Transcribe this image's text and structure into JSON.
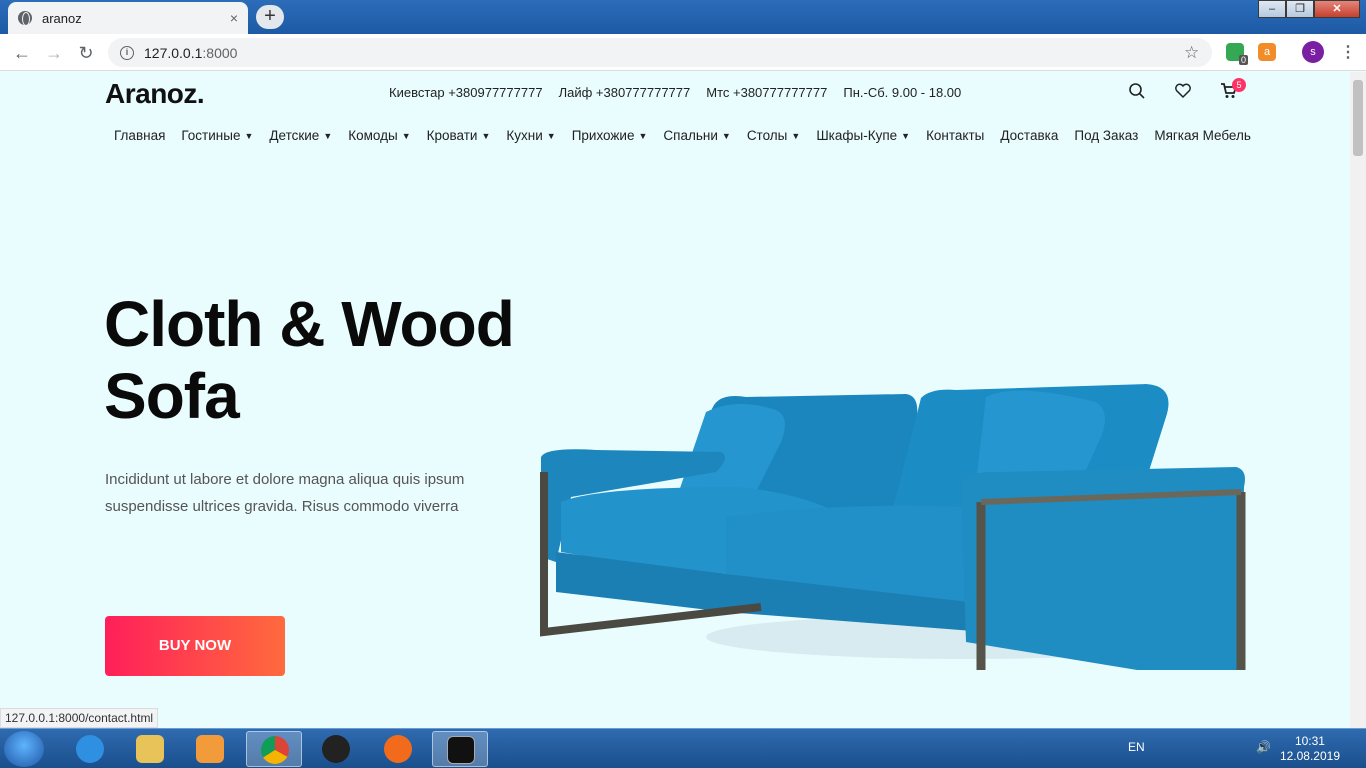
{
  "browser": {
    "tab_title": "aranoz",
    "tab_close": "×",
    "new_tab": "+",
    "url_host": "127.0.0.1",
    "url_port": ":8000",
    "extension_badge": "0",
    "profile_initial": "s",
    "status_url": "127.0.0.1:8000/contact.html"
  },
  "site": {
    "logo": "Aranoz.",
    "contacts": [
      "Киевстар +380977777777",
      "Лайф +380777777777",
      "Мтс +380777777777",
      "Пн.-Сб. 9.00 - 18.00"
    ],
    "cart_count": "5",
    "nav": [
      {
        "label": "Главная",
        "dropdown": false
      },
      {
        "label": "Гостиные",
        "dropdown": true
      },
      {
        "label": "Детские",
        "dropdown": true
      },
      {
        "label": "Комоды",
        "dropdown": true
      },
      {
        "label": "Кровати",
        "dropdown": true
      },
      {
        "label": "Кухни",
        "dropdown": true
      },
      {
        "label": "Прихожие",
        "dropdown": true
      },
      {
        "label": "Спальни",
        "dropdown": true
      },
      {
        "label": "Столы",
        "dropdown": true
      },
      {
        "label": "Шкафы-Купе",
        "dropdown": true
      },
      {
        "label": "Контакты",
        "dropdown": false
      },
      {
        "label": "Доставка",
        "dropdown": false
      },
      {
        "label": "Под Заказ",
        "dropdown": false
      },
      {
        "label": "Мягкая Мебель",
        "dropdown": false
      }
    ]
  },
  "hero": {
    "title_line1": "Cloth & Wood",
    "title_line2": "Sofa",
    "description": "Incididunt ut labore et dolore magna aliqua quis ipsum suspendisse ultrices gravida. Risus commodo viverra",
    "button": "BUY NOW"
  },
  "taskbar": {
    "lang": "EN",
    "time": "10:31",
    "date": "12.08.2019"
  },
  "colors": {
    "page_bg": "#e9fcfe",
    "button_start": "#ff1f5a",
    "button_end": "#ff6a3d",
    "sofa": "#1e8fc7",
    "badge": "#ff3366"
  }
}
